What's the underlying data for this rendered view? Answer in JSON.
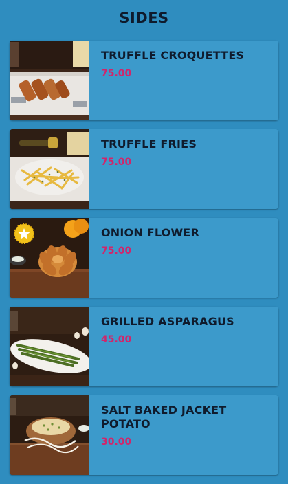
{
  "header": {
    "title": "SIDES"
  },
  "items": [
    {
      "name": "TRUFFLE CROQUETTES",
      "price": "75.00",
      "photo_icon": "croquettes-photo"
    },
    {
      "name": "TRUFFLE FRIES",
      "price": "75.00",
      "photo_icon": "fries-photo"
    },
    {
      "name": "ONION FLOWER",
      "price": "75.00",
      "photo_icon": "onion-flower-photo",
      "badge_icon": "star-badge-icon"
    },
    {
      "name": "GRILLED ASPARAGUS",
      "price": "45.00",
      "photo_icon": "asparagus-photo"
    },
    {
      "name": "SALT BAKED JACKET POTATO",
      "price": "30.00",
      "photo_icon": "jacket-potato-photo"
    }
  ],
  "colors": {
    "background": "#2f8dbf",
    "card": "#3c9acb",
    "title_text": "#0f1b2d",
    "price_text": "#d0266b",
    "badge": "#f2c21b"
  }
}
